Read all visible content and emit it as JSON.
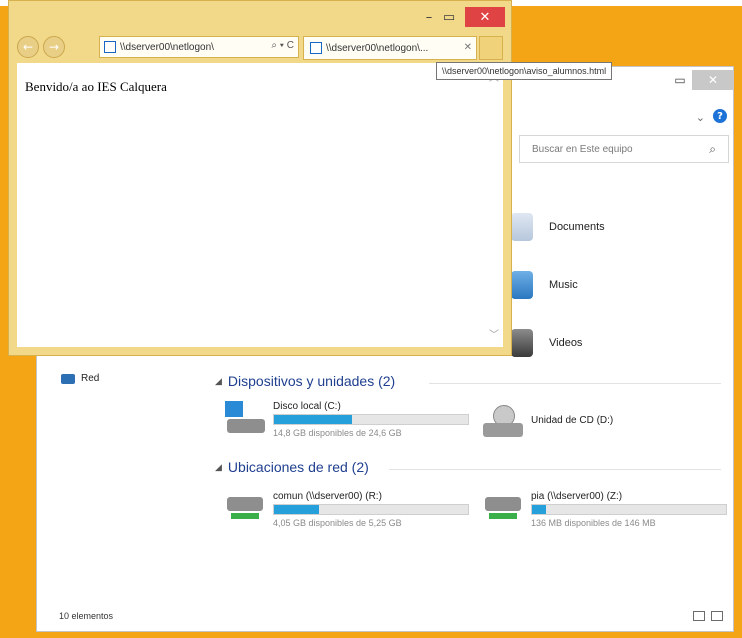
{
  "ie_window": {
    "minimize": "–",
    "maximize": "▭",
    "close": "✕",
    "back": "←",
    "forward": "→",
    "address": "\\\\dserver00\\netlogon\\",
    "address_tools": "⌕ ▾ C",
    "tab_title": "\\\\dserver00\\netlogon\\...",
    "tab_close": "✕",
    "tooltip": "\\\\dserver00\\netlogon\\aviso_alumnos.html",
    "page_text": "Benvido/a ao IES Calquera",
    "scroll_up": "︿",
    "scroll_down": "﹀"
  },
  "explorer": {
    "minimize": "–",
    "maximize": "▭",
    "close": "✕",
    "chevron": "⌄",
    "help": "?",
    "search_placeholder": "Buscar en Este equipo",
    "search_icon": "⌕",
    "folders": [
      {
        "label": "Documents"
      },
      {
        "label": "Music"
      },
      {
        "label": "Videos"
      }
    ],
    "nav_network": "Red",
    "groups": {
      "devices": "Dispositivos y unidades (2)",
      "network": "Ubicaciones de red (2)"
    },
    "drives": [
      {
        "name": "Disco local (C:)",
        "free": "14,8 GB disponibles de 24,6 GB",
        "used_fraction": 0.4
      },
      {
        "name": "Unidad de CD (D:)"
      },
      {
        "name": "comun (\\\\dserver00) (R:)",
        "free": "4,05 GB disponibles de 5,25 GB",
        "used_fraction": 0.23
      },
      {
        "name": "pia (\\\\dserver00) (Z:)",
        "free": "136 MB disponibles de 146 MB",
        "used_fraction": 0.07
      }
    ],
    "status": "10 elementos"
  },
  "colors": {
    "desktop": "#f3a516",
    "ie_frame": "#f2d98a",
    "progress": "#26a0da",
    "header_blue": "#1f3f8f"
  }
}
